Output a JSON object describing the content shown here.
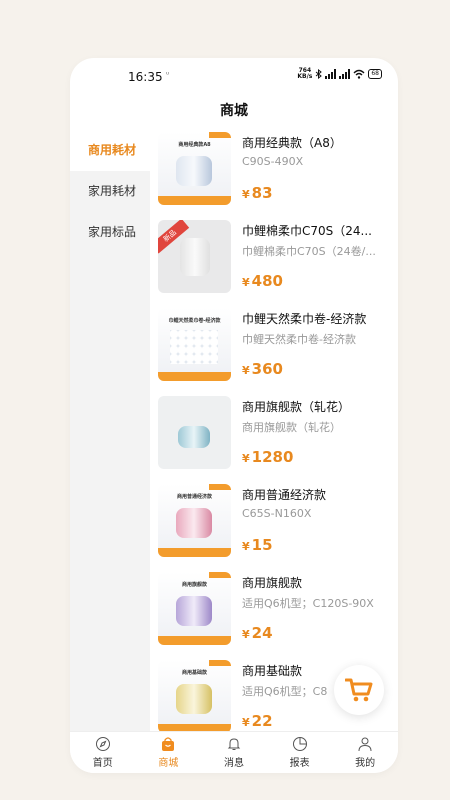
{
  "status": {
    "time": "16:35",
    "aux": "ᵁ",
    "speed_top": "764",
    "speed_bottom": "KB/s",
    "battery": "68"
  },
  "page": {
    "title": "商城"
  },
  "sidebar": {
    "items": [
      {
        "label": "商用耗材",
        "active": true
      },
      {
        "label": "家用耗材"
      },
      {
        "label": "家用标品"
      }
    ]
  },
  "products": [
    {
      "name": "商用经典款（A8）",
      "spec": "C90S-490X",
      "currency": "¥",
      "price": "83",
      "thumb_caption": "商用经典款A8"
    },
    {
      "name": "巾鲤棉柔巾C70S（24...",
      "spec": "巾鲤棉柔巾C70S（24卷/...",
      "currency": "¥",
      "price": "480",
      "badge": "新品"
    },
    {
      "name": "巾鲤天然柔巾卷-经济款",
      "spec": "巾鲤天然柔巾卷-经济款",
      "currency": "¥",
      "price": "360",
      "thumb_caption": "巾鲤天然柔巾卷-经济款"
    },
    {
      "name": "商用旗舰款（轧花）",
      "spec": "商用旗舰款（轧花）",
      "currency": "¥",
      "price": "1280"
    },
    {
      "name": "商用普通经济款",
      "spec": "C65S-N160X",
      "currency": "¥",
      "price": "15",
      "thumb_caption": "商用普通经济款"
    },
    {
      "name": "商用旗舰款",
      "spec": "适用Q6机型；C120S-90X",
      "currency": "¥",
      "price": "24",
      "thumb_caption": "商用旗舰款"
    },
    {
      "name": "商用基础款",
      "spec": "适用Q6机型；C8",
      "currency": "¥",
      "price": "22",
      "thumb_caption": "商用基础款"
    }
  ],
  "tabs": [
    {
      "label": "首页",
      "icon": "compass-icon"
    },
    {
      "label": "商城",
      "icon": "shopping-bag-icon",
      "active": true
    },
    {
      "label": "消息",
      "icon": "bell-icon"
    },
    {
      "label": "报表",
      "icon": "pie-chart-icon"
    },
    {
      "label": "我的",
      "icon": "user-icon"
    }
  ],
  "colors": {
    "accent": "#e8891f",
    "badge": "#e0453d"
  },
  "cart": {
    "icon": "shopping-cart-icon"
  }
}
